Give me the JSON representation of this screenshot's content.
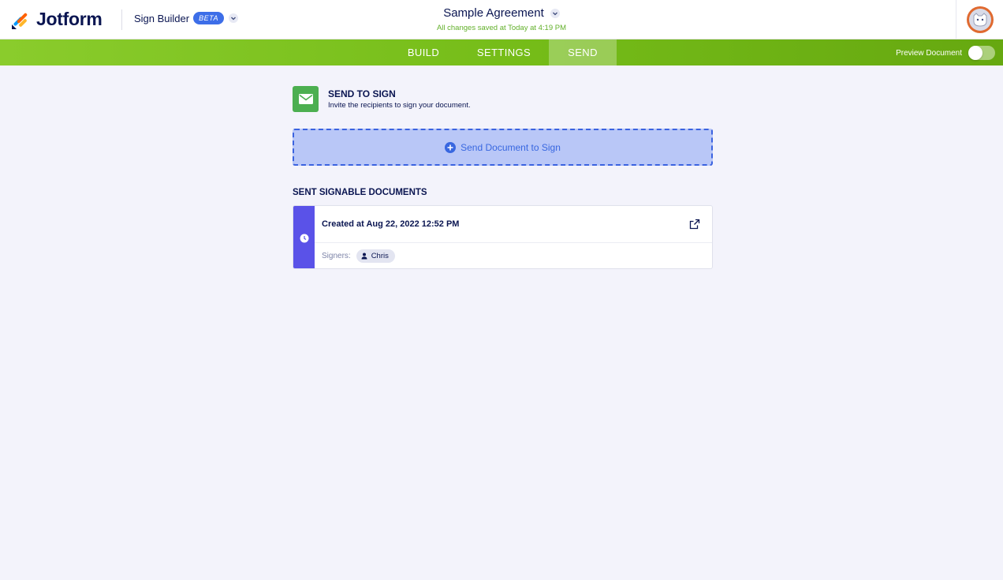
{
  "header": {
    "logo_text": "Jotform",
    "builder_label": "Sign Builder",
    "beta_badge": "BETA",
    "document_title": "Sample Agreement",
    "saved_status": "All changes saved at Today at 4:19 PM"
  },
  "tabs": [
    {
      "label": "BUILD",
      "active": false
    },
    {
      "label": "SETTINGS",
      "active": false
    },
    {
      "label": "SEND",
      "active": true
    }
  ],
  "preview": {
    "label": "Preview Document",
    "enabled": false
  },
  "send_section": {
    "title": "SEND TO SIGN",
    "subtitle": "Invite the recipients to sign your document.",
    "button_label": "Send Document to Sign"
  },
  "sent_documents": {
    "title": "SENT SIGNABLE DOCUMENTS",
    "items": [
      {
        "created": "Created at Aug 22, 2022 12:52 PM",
        "signers_label": "Signers:",
        "signers": [
          "Chris"
        ]
      }
    ]
  },
  "colors": {
    "brand_navy": "#0a1551",
    "tab_green": "#76bd19",
    "send_icon_green": "#4caf50",
    "send_button_bg": "#b9c7f7",
    "send_button_border": "#3b63e0",
    "card_stripe": "#5a52e8",
    "saved_green": "#62b02a"
  }
}
